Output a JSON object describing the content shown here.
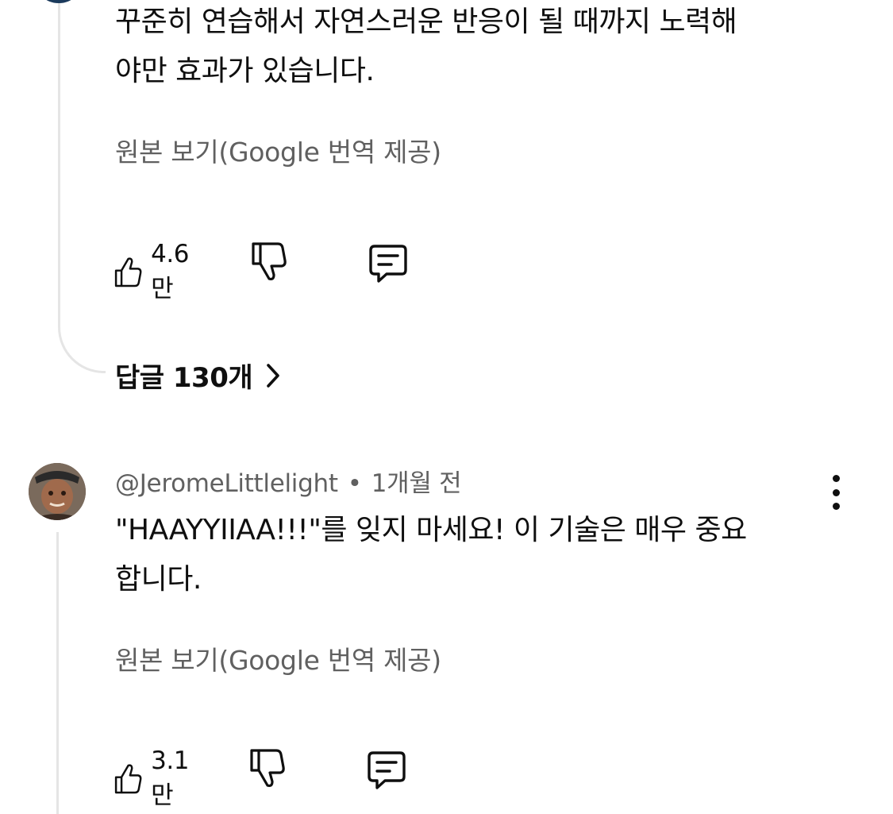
{
  "comment1": {
    "text_line1": "꾸준히 연습해서 자연스러운 반응이 될 때까지 노력해",
    "text_line2": "야만 효과가 있습니다.",
    "translate_link": "원본 보기(Google 번역 제공)",
    "like_count": "4.6만",
    "replies_label": "답글 130개"
  },
  "comment2": {
    "author": "@JeromeLittlelight",
    "separator": "•",
    "time": "1개월 전",
    "text_line1": "\"HAAYYIIAA!!!\"를 잊지 마세요! 이 기술은 매우 중요",
    "text_line2": "합니다.",
    "translate_link": "원본 보기(Google 번역 제공)",
    "like_count": "3.1만"
  },
  "icons": {
    "like": "thumbs-up-icon",
    "dislike": "thumbs-down-icon",
    "reply": "comment-icon",
    "more": "more-vert-icon",
    "chevron": "chevron-right-icon"
  },
  "colors": {
    "text": "#0f0f0f",
    "secondary": "#606060",
    "thread_line": "#e5e5e5"
  }
}
